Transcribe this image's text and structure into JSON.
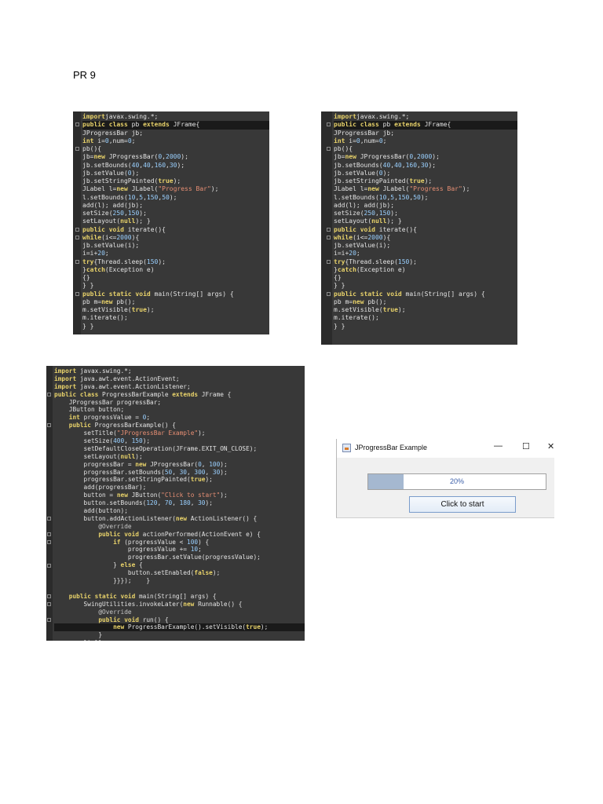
{
  "document": {
    "heading": "PR 9"
  },
  "colors": {
    "code_background": "#383838",
    "keyword": "#e8d26a",
    "string": "#e88f74",
    "progress_fill": "#a5b8d0"
  },
  "code_snippet_1": [
    [
      [
        "kw",
        "import"
      ],
      [
        "",
        "javax.swing.*;"
      ]
    ],
    [
      [
        "kw",
        "public class "
      ],
      [
        "",
        "pb "
      ],
      [
        "kw",
        "extends "
      ],
      [
        "",
        "JFrame{"
      ]
    ],
    [
      [
        "",
        "JProgressBar jb;"
      ]
    ],
    [
      [
        "kw",
        "int "
      ],
      [
        "",
        "i="
      ],
      [
        "num",
        "0"
      ],
      [
        "",
        ",num="
      ],
      [
        "num",
        "0"
      ],
      [
        "",
        ";"
      ]
    ],
    [
      [
        "",
        "pb(){"
      ]
    ],
    [
      [
        "",
        "jb="
      ],
      [
        "kw",
        "new "
      ],
      [
        "",
        "JProgressBar("
      ],
      [
        "num",
        "0"
      ],
      [
        "",
        ","
      ],
      [
        "num",
        "2000"
      ],
      [
        "",
        "); "
      ]
    ],
    [
      [
        "",
        "jb.setBounds("
      ],
      [
        "num",
        "40"
      ],
      [
        "",
        ","
      ],
      [
        "num",
        "40"
      ],
      [
        "",
        ","
      ],
      [
        "num",
        "160"
      ],
      [
        "",
        ","
      ],
      [
        "num",
        "30"
      ],
      [
        "",
        "); "
      ]
    ],
    [
      [
        "",
        "jb.setValue("
      ],
      [
        "num",
        "0"
      ],
      [
        "",
        "); "
      ]
    ],
    [
      [
        "",
        "jb.setStringPainted("
      ],
      [
        "kw",
        "true"
      ],
      [
        "",
        "); "
      ]
    ],
    [
      [
        "",
        "JLabel l="
      ],
      [
        "kw",
        "new "
      ],
      [
        "",
        "JLabel("
      ],
      [
        "str",
        "\"Progress Bar\""
      ],
      [
        "",
        "); "
      ]
    ],
    [
      [
        "",
        "l.setBounds("
      ],
      [
        "num",
        "10"
      ],
      [
        "",
        ","
      ],
      [
        "num",
        "5"
      ],
      [
        "",
        ","
      ],
      [
        "num",
        "150"
      ],
      [
        "",
        ","
      ],
      [
        "num",
        "50"
      ],
      [
        "",
        "); "
      ]
    ],
    [
      [
        "",
        "add(l); add(jb);"
      ]
    ],
    [
      [
        "",
        "setSize("
      ],
      [
        "num",
        "250"
      ],
      [
        "",
        ","
      ],
      [
        "num",
        "150"
      ],
      [
        "",
        "); "
      ]
    ],
    [
      [
        "",
        "setLayout("
      ],
      [
        "kw",
        "null"
      ],
      [
        "",
        "); }"
      ]
    ],
    [
      [
        "kw",
        "public void "
      ],
      [
        "",
        "iterate(){"
      ]
    ],
    [
      [
        "kw",
        "while"
      ],
      [
        "",
        "(i<="
      ],
      [
        "num",
        "2000"
      ],
      [
        "",
        "){"
      ]
    ],
    [
      [
        "",
        "jb.setValue(i);"
      ]
    ],
    [
      [
        "",
        "i=i+"
      ],
      [
        "num",
        "20"
      ],
      [
        "",
        ";"
      ]
    ],
    [
      [
        "kw",
        "try"
      ],
      [
        "",
        "{Thread.sleep("
      ],
      [
        "num",
        "150"
      ],
      [
        "",
        "); "
      ]
    ],
    [
      [
        "",
        "}"
      ],
      [
        "kw",
        "catch"
      ],
      [
        "",
        "(Exception e)"
      ]
    ],
    [
      [
        "",
        "{}"
      ]
    ],
    [
      [
        "",
        "} }"
      ]
    ],
    [
      [
        "kw",
        "public static void "
      ],
      [
        "",
        "main(String[] args) {"
      ]
    ],
    [
      [
        "",
        "pb m="
      ],
      [
        "kw",
        "new "
      ],
      [
        "",
        "pb();"
      ]
    ],
    [
      [
        "",
        "m.setVisible("
      ],
      [
        "kw",
        "true"
      ],
      [
        "",
        "); "
      ]
    ],
    [
      [
        "",
        "m.iterate();"
      ]
    ],
    [
      [
        "",
        "} }"
      ]
    ]
  ],
  "code_snippet_2": [
    [
      [
        "kw",
        "import"
      ],
      [
        "",
        "javax.swing.*;"
      ]
    ],
    [
      [
        "kw",
        "public class "
      ],
      [
        "",
        "pb "
      ],
      [
        "kw",
        "extends "
      ],
      [
        "",
        "JFrame{"
      ]
    ],
    [
      [
        "",
        "JProgressBar jb;"
      ]
    ],
    [
      [
        "kw",
        "int "
      ],
      [
        "",
        "i="
      ],
      [
        "num",
        "0"
      ],
      [
        "",
        ",num="
      ],
      [
        "num",
        "0"
      ],
      [
        "",
        ";"
      ]
    ],
    [
      [
        "",
        "pb(){"
      ]
    ],
    [
      [
        "",
        "jb="
      ],
      [
        "kw",
        "new "
      ],
      [
        "",
        "JProgressBar("
      ],
      [
        "num",
        "0"
      ],
      [
        "",
        ","
      ],
      [
        "num",
        "2000"
      ],
      [
        "",
        "); "
      ]
    ],
    [
      [
        "",
        "jb.setBounds("
      ],
      [
        "num",
        "40"
      ],
      [
        "",
        ","
      ],
      [
        "num",
        "40"
      ],
      [
        "",
        ","
      ],
      [
        "num",
        "160"
      ],
      [
        "",
        ","
      ],
      [
        "num",
        "30"
      ],
      [
        "",
        "); "
      ]
    ],
    [
      [
        "",
        "jb.setValue("
      ],
      [
        "num",
        "0"
      ],
      [
        "",
        "); "
      ]
    ],
    [
      [
        "",
        "jb.setStringPainted("
      ],
      [
        "kw",
        "true"
      ],
      [
        "",
        "); "
      ]
    ],
    [
      [
        "",
        "JLabel l="
      ],
      [
        "kw",
        "new "
      ],
      [
        "",
        "JLabel("
      ],
      [
        "str",
        "\"Progress Bar\""
      ],
      [
        "",
        "); "
      ]
    ],
    [
      [
        "",
        "l.setBounds("
      ],
      [
        "num",
        "10"
      ],
      [
        "",
        ","
      ],
      [
        "num",
        "5"
      ],
      [
        "",
        ","
      ],
      [
        "num",
        "150"
      ],
      [
        "",
        ","
      ],
      [
        "num",
        "50"
      ],
      [
        "",
        "); "
      ]
    ],
    [
      [
        "",
        "add(l); add(jb);"
      ]
    ],
    [
      [
        "",
        "setSize("
      ],
      [
        "num",
        "250"
      ],
      [
        "",
        ","
      ],
      [
        "num",
        "150"
      ],
      [
        "",
        "); "
      ]
    ],
    [
      [
        "",
        "setLayout("
      ],
      [
        "kw",
        "null"
      ],
      [
        "",
        "); }"
      ]
    ],
    [
      [
        "kw",
        "public void "
      ],
      [
        "",
        "iterate(){"
      ]
    ],
    [
      [
        "kw",
        "while"
      ],
      [
        "",
        "(i<="
      ],
      [
        "num",
        "2000"
      ],
      [
        "",
        "){"
      ]
    ],
    [
      [
        "",
        "jb.setValue(i);"
      ]
    ],
    [
      [
        "",
        "i=i+"
      ],
      [
        "num",
        "20"
      ],
      [
        "",
        ";"
      ]
    ],
    [
      [
        "kw",
        "try"
      ],
      [
        "",
        "{Thread.sleep("
      ],
      [
        "num",
        "150"
      ],
      [
        "",
        "); "
      ]
    ],
    [
      [
        "",
        "}"
      ],
      [
        "kw",
        "catch"
      ],
      [
        "",
        "(Exception e)"
      ]
    ],
    [
      [
        "",
        "{}"
      ]
    ],
    [
      [
        "",
        "} }"
      ]
    ],
    [
      [
        "kw",
        "public static void "
      ],
      [
        "",
        "main(String[] args) {"
      ]
    ],
    [
      [
        "",
        "pb m="
      ],
      [
        "kw",
        "new "
      ],
      [
        "",
        "pb();"
      ]
    ],
    [
      [
        "",
        "m.setVisible("
      ],
      [
        "kw",
        "true"
      ],
      [
        "",
        "); "
      ]
    ],
    [
      [
        "",
        "m.iterate();"
      ]
    ],
    [
      [
        "",
        "} }"
      ]
    ]
  ],
  "code_snippet_3": [
    [
      [
        "kw",
        "import "
      ],
      [
        "",
        "javax.swing.*;"
      ]
    ],
    [
      [
        "kw",
        "import "
      ],
      [
        "",
        "java.awt.event.ActionEvent;"
      ]
    ],
    [
      [
        "kw",
        "import "
      ],
      [
        "",
        "java.awt.event.ActionListener;"
      ]
    ],
    [
      [
        "kw",
        "public class "
      ],
      [
        "",
        "ProgressBarExample "
      ],
      [
        "kw",
        "extends "
      ],
      [
        "",
        "JFrame {"
      ]
    ],
    [
      [
        "",
        "    JProgressBar progressBar;"
      ]
    ],
    [
      [
        "",
        "    JButton button;"
      ]
    ],
    [
      [
        "kw",
        "    int "
      ],
      [
        "",
        "progressValue = "
      ],
      [
        "num",
        "0"
      ],
      [
        "",
        ";"
      ]
    ],
    [
      [
        "kw",
        "    public "
      ],
      [
        "",
        "ProgressBarExample() {"
      ]
    ],
    [
      [
        "",
        "        setTitle("
      ],
      [
        "str",
        "\"JProgressBar Example\""
      ],
      [
        "",
        ");"
      ]
    ],
    [
      [
        "",
        "        setSize("
      ],
      [
        "num",
        "400"
      ],
      [
        "",
        ", "
      ],
      [
        "num",
        "150"
      ],
      [
        "",
        ");"
      ]
    ],
    [
      [
        "",
        "        setDefaultCloseOperation(JFrame.EXIT_ON_CLOSE);"
      ]
    ],
    [
      [
        "",
        "        setLayout("
      ],
      [
        "kw",
        "null"
      ],
      [
        "",
        ");"
      ]
    ],
    [
      [
        "",
        "        progressBar = "
      ],
      [
        "kw",
        "new "
      ],
      [
        "",
        "JProgressBar("
      ],
      [
        "num",
        "0"
      ],
      [
        "",
        ", "
      ],
      [
        "num",
        "100"
      ],
      [
        "",
        ");"
      ]
    ],
    [
      [
        "",
        "        progressBar.setBounds("
      ],
      [
        "num",
        "50"
      ],
      [
        "",
        ", "
      ],
      [
        "num",
        "30"
      ],
      [
        "",
        ", "
      ],
      [
        "num",
        "300"
      ],
      [
        "",
        ", "
      ],
      [
        "num",
        "30"
      ],
      [
        "",
        ");"
      ]
    ],
    [
      [
        "",
        "        progressBar.setStringPainted("
      ],
      [
        "kw",
        "true"
      ],
      [
        "",
        ");"
      ]
    ],
    [
      [
        "",
        "        add(progressBar);"
      ]
    ],
    [
      [
        "",
        "        button = "
      ],
      [
        "kw",
        "new "
      ],
      [
        "",
        "JButton("
      ],
      [
        "str",
        "\"Click to start\""
      ],
      [
        "",
        ");"
      ]
    ],
    [
      [
        "",
        "        button.setBounds("
      ],
      [
        "num",
        "120"
      ],
      [
        "",
        ", "
      ],
      [
        "num",
        "70"
      ],
      [
        "",
        ", "
      ],
      [
        "num",
        "180"
      ],
      [
        "",
        ", "
      ],
      [
        "num",
        "30"
      ],
      [
        "",
        ");"
      ]
    ],
    [
      [
        "",
        "        add(button);"
      ]
    ],
    [
      [
        "",
        "        button.addActionListener("
      ],
      [
        "kw",
        "new "
      ],
      [
        "",
        "ActionListener() {"
      ]
    ],
    [
      [
        "anno",
        "            @Override"
      ]
    ],
    [
      [
        "kw",
        "            public void "
      ],
      [
        "",
        "actionPerformed(ActionEvent e) {"
      ]
    ],
    [
      [
        "kw",
        "                if "
      ],
      [
        "",
        "(progressValue < "
      ],
      [
        "num",
        "100"
      ],
      [
        "",
        ") {"
      ]
    ],
    [
      [
        "",
        "                    progressValue += "
      ],
      [
        "num",
        "10"
      ],
      [
        "",
        ";"
      ]
    ],
    [
      [
        "",
        "                    progressBar.setValue(progressValue);"
      ]
    ],
    [
      [
        "",
        "                } "
      ],
      [
        "kw",
        "else "
      ],
      [
        "",
        "{"
      ]
    ],
    [
      [
        "",
        "                    button.setEnabled("
      ],
      [
        "kw",
        "false"
      ],
      [
        "",
        ");"
      ]
    ],
    [
      [
        "",
        "                }}});    }"
      ]
    ],
    [
      [
        "",
        ""
      ]
    ],
    [
      [
        "kw",
        "    public static void "
      ],
      [
        "",
        "main(String[] args) {"
      ]
    ],
    [
      [
        "",
        "        SwingUtilities.invokeLater("
      ],
      [
        "kw",
        "new "
      ],
      [
        "",
        "Runnable() {"
      ]
    ],
    [
      [
        "anno",
        "            @Override"
      ]
    ],
    [
      [
        "kw",
        "            public void "
      ],
      [
        "",
        "run() {"
      ]
    ],
    [
      [
        "kw",
        "                new "
      ],
      [
        "",
        "ProgressBarExample().setVisible("
      ],
      [
        "kw",
        "true"
      ],
      [
        "",
        ");"
      ]
    ],
    [
      [
        "",
        "            }"
      ]
    ],
    [
      [
        "",
        "        });}}"
      ]
    ]
  ],
  "swing_window": {
    "title": "JProgressBar Example",
    "minimize": "—",
    "maximize": "☐",
    "close": "✕",
    "progress_percent": 20,
    "progress_text": "20%",
    "button_label": "Click to start"
  }
}
